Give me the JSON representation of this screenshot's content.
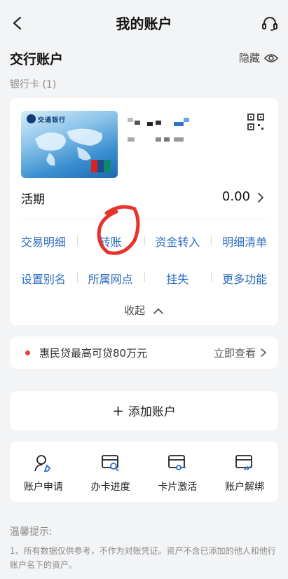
{
  "header": {
    "title": "我的账户",
    "back_icon": "chevron-left-icon",
    "support_icon": "headset-icon"
  },
  "section": {
    "title": "交行账户",
    "hide_label": "隐藏",
    "subtitle": "银行卡 (1)"
  },
  "card": {
    "bank_name": "交通银行",
    "account_type": "活期",
    "balance": "0.00",
    "actions_row1": [
      "交易明细",
      "转账",
      "资金转入",
      "明细清单"
    ],
    "actions_row2": [
      "设置别名",
      "所属网点",
      "挂失",
      "更多功能"
    ],
    "collapse_label": "收起"
  },
  "promo": {
    "text": "惠民贷最高可贷80万元",
    "link": "立即查看"
  },
  "add_account": {
    "label": "添加账户"
  },
  "services": [
    {
      "label": "账户申请",
      "icon": "user-edit-icon"
    },
    {
      "label": "办卡进度",
      "icon": "card-search-icon"
    },
    {
      "label": "卡片激活",
      "icon": "card-key-icon"
    },
    {
      "label": "账户解绑",
      "icon": "card-link-icon"
    }
  ],
  "tips": {
    "title": "温馨提示:",
    "text": "1、所有数据仅供参考，不作为对账凭证。资产不含已添加的他人和他行账户名下的资产。"
  },
  "colors": {
    "accent": "#2b6ec0",
    "promo_dot": "#e0443a",
    "annotation": "#e8322e"
  }
}
